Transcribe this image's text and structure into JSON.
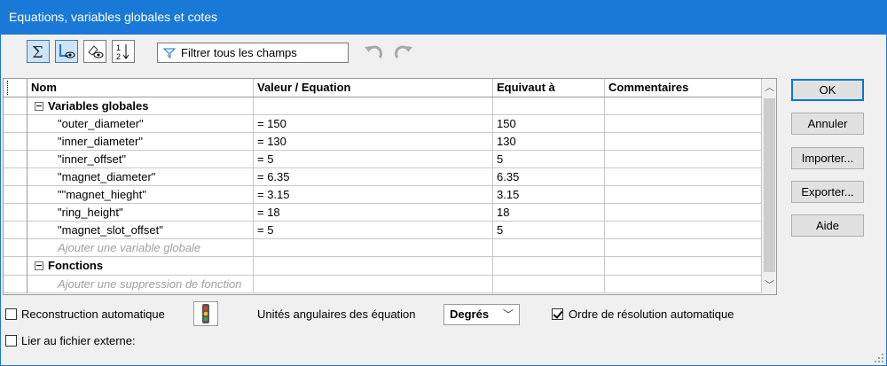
{
  "window": {
    "title": "Equations, variables globales et cotes"
  },
  "toolbar": {
    "filter_label": "Filtrer tous les champs",
    "icons": [
      "equation-view-icon",
      "sketch-equation-view-icon",
      "dimension-view-icon",
      "ordered-view-icon",
      "undo-icon",
      "redo-icon"
    ]
  },
  "table": {
    "headers": {
      "name": "Nom",
      "value": "Valeur / Equation",
      "evaluates": "Equivaut à",
      "comments": "Commentaires"
    },
    "global_group": "Variables globales",
    "variables": [
      {
        "name": "\"outer_diameter\"",
        "value": "= 150",
        "evaluates": "150",
        "comment": ""
      },
      {
        "name": "\"inner_diameter\"",
        "value": "= 130",
        "evaluates": "130",
        "comment": ""
      },
      {
        "name": "\"inner_offset\"",
        "value": "= 5",
        "evaluates": "5",
        "comment": ""
      },
      {
        "name": "\"magnet_diameter\"",
        "value": "= 6.35",
        "evaluates": "6.35",
        "comment": ""
      },
      {
        "name": "\"\"magnet_hieght\"",
        "value": "= 3.15",
        "evaluates": "3.15",
        "comment": ""
      },
      {
        "name": "\"ring_height\"",
        "value": "= 18",
        "evaluates": "18",
        "comment": ""
      },
      {
        "name": "\"magnet_slot_offset\"",
        "value": "= 5",
        "evaluates": "5",
        "comment": ""
      }
    ],
    "add_global_hint": "Ajouter une variable globale",
    "functions_group": "Fonctions",
    "add_function_hint": "Ajouter une suppression de fonction"
  },
  "buttons": {
    "ok": "OK",
    "cancel": "Annuler",
    "import": "Importer...",
    "export": "Exporter...",
    "help": "Aide"
  },
  "options": {
    "auto_rebuild": {
      "label": "Reconstruction automatique",
      "checked": false
    },
    "angular_units_label": "Unités angulaires des équation",
    "angular_units_value": "Degrés",
    "auto_solve_order": {
      "label": "Ordre de résolution automatique",
      "checked": true
    },
    "link_external": {
      "label": "Lier au fichier externe:",
      "checked": false
    }
  },
  "colors": {
    "titlebar": "#1a78d7",
    "accent": "#0078d7"
  }
}
